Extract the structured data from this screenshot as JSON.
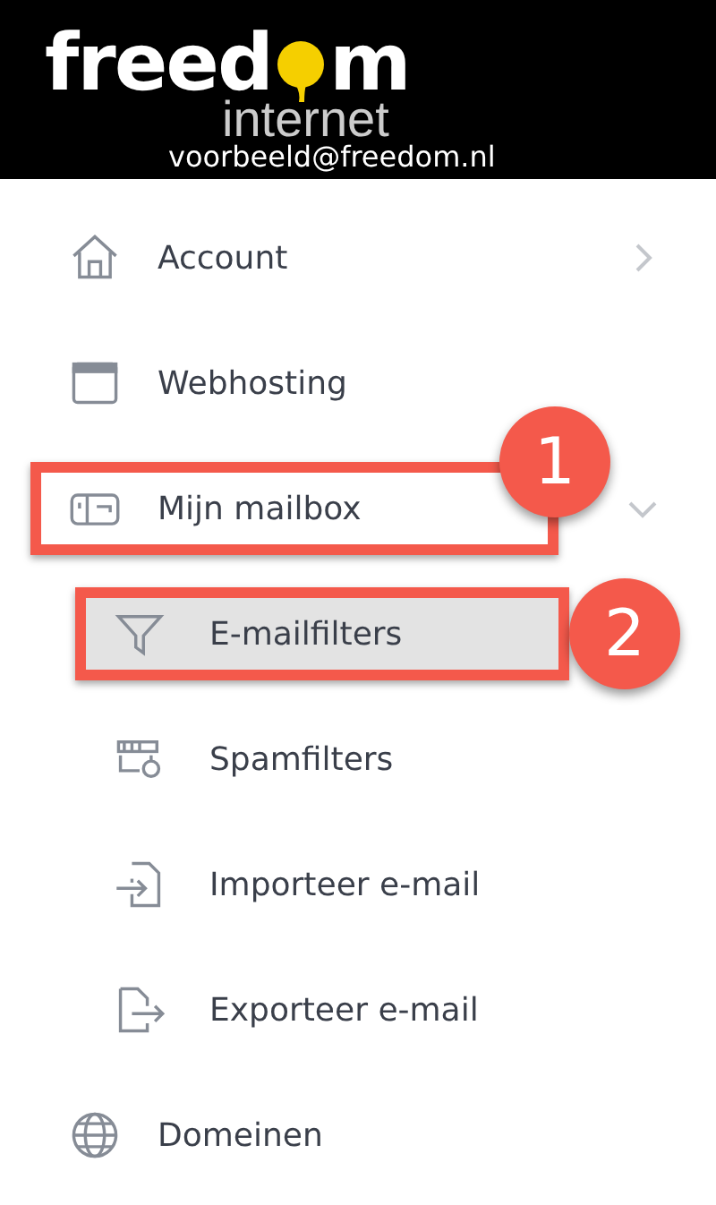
{
  "header": {
    "logo": {
      "start": "freed",
      "end": "m",
      "tagline": "internet"
    },
    "email": "voorbeeld@freedom.nl"
  },
  "menu": [
    {
      "label": "Account",
      "kind": "group",
      "expanded": false,
      "selected": false
    },
    {
      "label": "Webhosting",
      "kind": "link",
      "selected": false
    },
    {
      "label": "Mijn mailbox",
      "kind": "group",
      "expanded": true,
      "selected": false,
      "annotation": {
        "number": "1"
      },
      "children": [
        {
          "label": "E-mailfilters",
          "selected": true,
          "annotation": {
            "number": "2"
          }
        },
        {
          "label": "Spamfilters",
          "selected": false
        },
        {
          "label": "Importeer e-mail",
          "selected": false
        },
        {
          "label": "Exporteer e-mail",
          "selected": false
        }
      ]
    },
    {
      "label": "Domeinen",
      "kind": "link",
      "selected": false
    }
  ]
}
